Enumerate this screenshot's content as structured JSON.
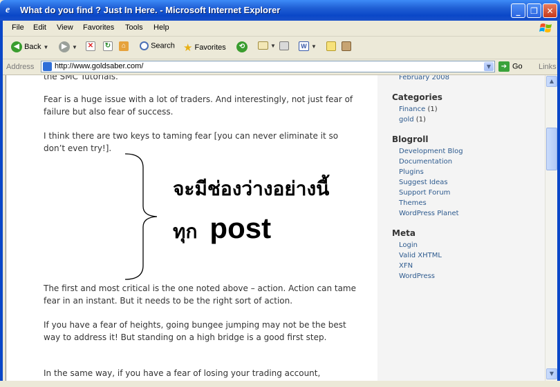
{
  "window": {
    "title": "What do you find ? Just In Here. - Microsoft Internet Explorer",
    "minimize": "_",
    "maximize": "❐",
    "close": "✕"
  },
  "menu": [
    "File",
    "Edit",
    "View",
    "Favorites",
    "Tools",
    "Help"
  ],
  "toolbar": {
    "back": "Back",
    "search": "Search",
    "favorites": "Favorites"
  },
  "address": {
    "label": "Address",
    "url": "http://www.goldsaber.com/",
    "go": "Go",
    "links": "Links"
  },
  "article": {
    "partial_top": "the SMC Tutorials.",
    "p1": "Fear is a huge issue with a lot of traders. And interestingly, not just fear of failure but also fear of success.",
    "p2": "I think there are two keys to taming fear [you can never eliminate it so don’t even try!].",
    "annotation_line1": "จะมีช่องว่างอย่างนี้",
    "annotation_line2_thai": "ทุก",
    "annotation_line2_word": "post",
    "p3": "The first and most critical is the one noted above – action. Action can tame fear in an instant. But it needs to be the right sort of action.",
    "p4": "If you have a fear of heights, going bungee jumping may not be the best way to address it! But standing on a high bridge is a good first step.",
    "p5": "In the same way, if you have a fear of losing your trading account,"
  },
  "sidebar": {
    "archive_partial": "February 2008",
    "categories_title": "Categories",
    "categories": [
      {
        "name": "Finance",
        "count": "(1)"
      },
      {
        "name": "gold",
        "count": "(1)"
      }
    ],
    "blogroll_title": "Blogroll",
    "blogroll": [
      "Development Blog",
      "Documentation",
      "Plugins",
      "Suggest Ideas",
      "Support Forum",
      "Themes",
      "WordPress Planet"
    ],
    "meta_title": "Meta",
    "meta": [
      "Login",
      "Valid XHTML",
      "XFN",
      "WordPress"
    ]
  }
}
